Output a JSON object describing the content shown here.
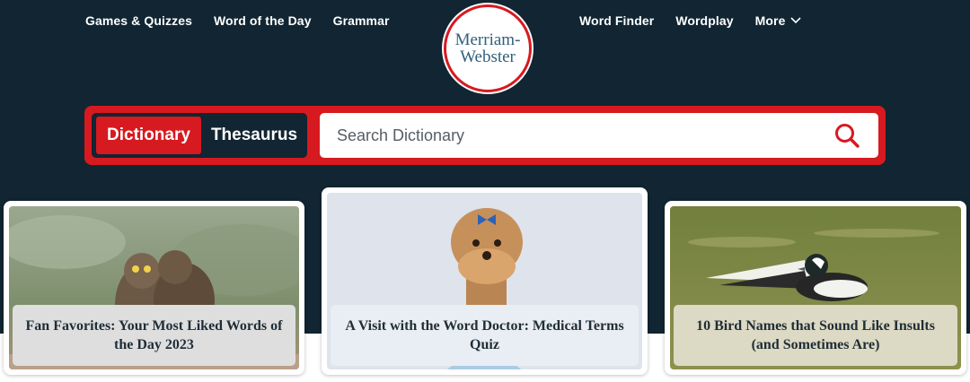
{
  "nav": {
    "left": [
      "Games & Quizzes",
      "Word of the Day",
      "Grammar"
    ],
    "right": [
      "Word Finder",
      "Wordplay",
      "More"
    ]
  },
  "logo": {
    "line1": "Merriam-",
    "line2": "Webster"
  },
  "search": {
    "tab_dictionary": "Dictionary",
    "tab_thesaurus": "Thesaurus",
    "placeholder": "Search Dictionary",
    "icon": "magnifier-icon"
  },
  "cards": [
    {
      "title": "Fan Favorites: Your Most Liked Words of the Day 2023",
      "image": "owls-photo"
    },
    {
      "title": "A Visit with the Word Doctor: Medical Terms Quiz",
      "image": "yorkie-doctor-photo"
    },
    {
      "title": "10 Bird Names that Sound Like Insults (and Sometimes Are)",
      "image": "bufflehead-duck-photo"
    }
  ],
  "colors": {
    "header_bg": "#112532",
    "brand_red": "#d71920",
    "logo_blue": "#305f7a"
  }
}
